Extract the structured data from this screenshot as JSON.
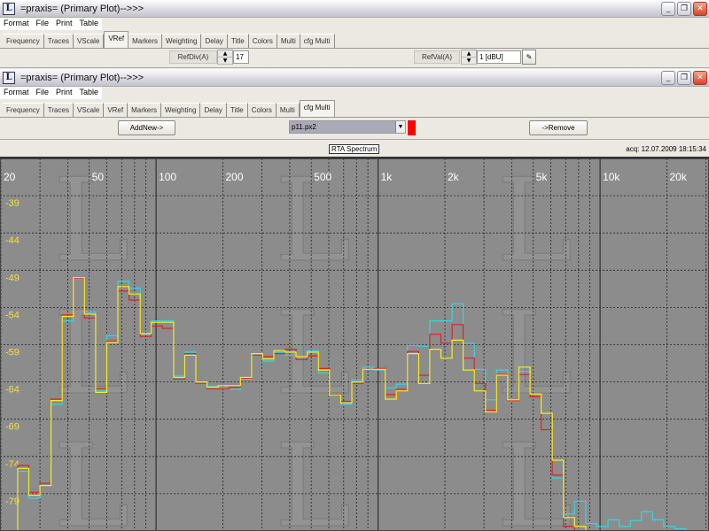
{
  "window1": {
    "title": "=praxis= (Primary Plot)-->>>",
    "menu": [
      "Format",
      "File",
      "Print",
      "Table"
    ],
    "tabs": [
      "Frequency",
      "Traces",
      "VScale",
      "VRef",
      "Markers",
      "Weighting",
      "Delay",
      "Title",
      "Colors",
      "Multi",
      "cfg Multi"
    ],
    "active_tab": "VRef",
    "refdiv_label": "RefDiv(A)",
    "refdiv_value": "17",
    "refval_label": "RefVal(A)",
    "refval_value": "1 [dBU]"
  },
  "window2": {
    "title": "=praxis= (Primary Plot)-->>>",
    "menu": [
      "Format",
      "File",
      "Print",
      "Table"
    ],
    "tabs": [
      "Frequency",
      "Traces",
      "VScale",
      "VRef",
      "Markers",
      "Weighting",
      "Delay",
      "Title",
      "Colors",
      "Multi",
      "cfg Multi"
    ],
    "active_tab": "cfg Multi",
    "addnew_label": "AddNew->",
    "selected_file": "p11.px2",
    "remove_label": "->Remove",
    "trace_color": "#ff0000"
  },
  "plot": {
    "title": "RTA Spectrum",
    "timestamp": "acq: 12.07.2009 18:15:34"
  },
  "chart_data": {
    "type": "line",
    "title": "RTA Spectrum",
    "xscale": "log",
    "xlim": [
      20,
      31000
    ],
    "ylim": [
      -84,
      -34
    ],
    "x_tick_labels": [
      {
        "v": 20,
        "t": "20"
      },
      {
        "v": 50,
        "t": "50"
      },
      {
        "v": 100,
        "t": "100"
      },
      {
        "v": 200,
        "t": "200"
      },
      {
        "v": 500,
        "t": "500"
      },
      {
        "v": 1000,
        "t": "1k"
      },
      {
        "v": 2000,
        "t": "2k"
      },
      {
        "v": 5000,
        "t": "5k"
      },
      {
        "v": 10000,
        "t": "10k"
      },
      {
        "v": 20000,
        "t": "20k"
      }
    ],
    "y_ticks": [
      -39,
      -44,
      -49,
      -54,
      -59,
      -64,
      -69,
      -74,
      -79
    ],
    "grid": true,
    "band_start_hz": 23.8,
    "bands_per_octave": 6,
    "series": [
      {
        "name": "trace-cyan",
        "color": "#33d6e0",
        "values": [
          -76,
          -79.6,
          -77.6,
          -67,
          -55.8,
          -50.2,
          -54.6,
          -65.2,
          -57.8,
          -50.5,
          -51.4,
          -57.6,
          -55.8,
          -55.8,
          -63.2,
          -60,
          -64.2,
          -64.6,
          -64.8,
          -65,
          -63.6,
          -60.4,
          -61.2,
          -60,
          -60.4,
          -61,
          -59.8,
          -62.8,
          -66,
          -67,
          -63.7,
          -62,
          -62.4,
          -64.8,
          -64.3,
          -59.1,
          -59.2,
          -55.8,
          -55.8,
          -53.5,
          -58.8,
          -62.3,
          -66.4,
          -62.4,
          -66.4,
          -62.6,
          -65.6,
          -70.4,
          -76.9,
          -81.7,
          -80,
          -83,
          -83.4,
          -82.5,
          -83.4,
          -82.6,
          -81.4,
          -82.5,
          -83.4,
          -83.7,
          -86
        ]
      },
      {
        "name": "trace-red",
        "color": "#e02020",
        "values": [
          -75.2,
          -78.8,
          -77.6,
          -66.3,
          -55,
          -50.1,
          -55.4,
          -64.9,
          -58.5,
          -51.8,
          -53,
          -57.9,
          -56.5,
          -56.8,
          -63.6,
          -60.2,
          -64.2,
          -64.9,
          -64.9,
          -64.7,
          -63.5,
          -60.4,
          -60.6,
          -60.2,
          -59.6,
          -61,
          -60.5,
          -62.2,
          -65.9,
          -66.6,
          -64.2,
          -62.3,
          -62.2,
          -65.7,
          -65,
          -59.9,
          -63.1,
          -57.6,
          -58.8,
          -56.3,
          -60.8,
          -64.2,
          -67.8,
          -63,
          -66.5,
          -63,
          -66,
          -70.4,
          -76.5,
          -83.4,
          -86
        ]
      },
      {
        "name": "trace-yellow",
        "color": "#f4f020",
        "values": [
          -75.6,
          -79.2,
          -77.9,
          -66.5,
          -55.2,
          -50,
          -54.9,
          -65.4,
          -58.7,
          -51.2,
          -52.2,
          -57.5,
          -56,
          -56,
          -63.4,
          -60.4,
          -64,
          -64.7,
          -64.5,
          -64.5,
          -63.4,
          -60.2,
          -60.9,
          -59.8,
          -60,
          -60.6,
          -60,
          -62.4,
          -65.8,
          -66.8,
          -64,
          -62.3,
          -62.3,
          -66.3,
          -65.2,
          -60.2,
          -64.2,
          -59.6,
          -60.8,
          -58.4,
          -62.4,
          -65.2,
          -68,
          -63.1,
          -66.4,
          -62,
          -65.6,
          -68.2,
          -74.5,
          -82.2,
          -83.4,
          -86
        ]
      }
    ]
  }
}
